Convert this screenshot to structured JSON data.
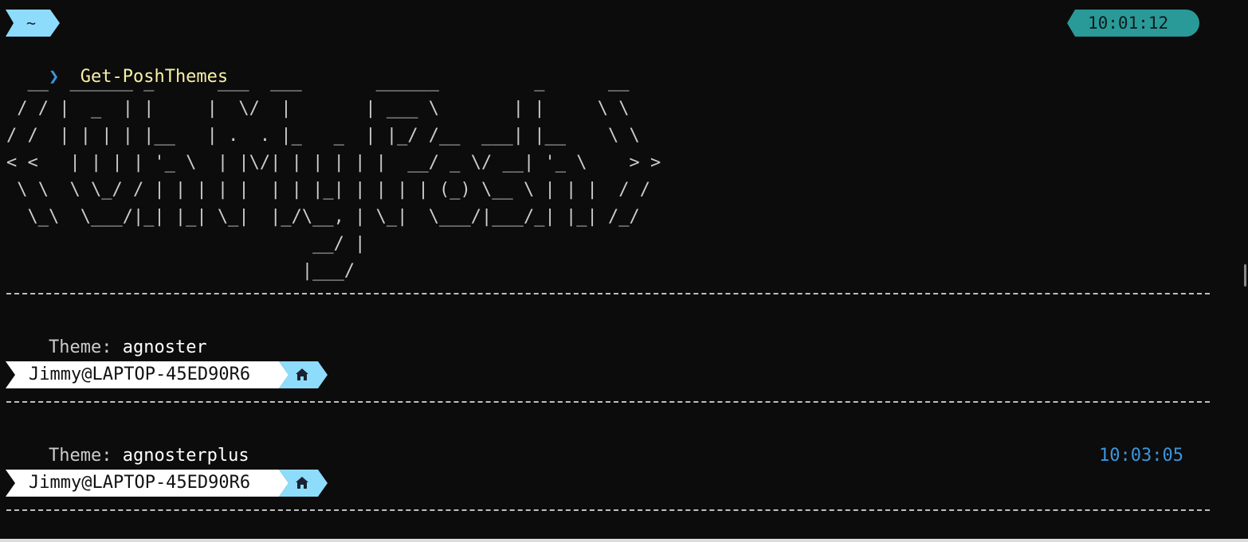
{
  "prompt": {
    "path": "~",
    "time": "10:01:12",
    "chevron": "❯",
    "command": "Get-PoshThemes"
  },
  "banner_ascii": [
    "  __  ______ _      ___  ___       ______         _      __",
    " / / |  _  | |     |  \\/  |       | ___ \\       | |     \\ \\",
    "/ /  | | | | |__   | .  . |_   _  | |_/ /__  ___| |__    \\ \\",
    "< <   | | | | '_ \\  | |\\/| | | | | |  __/ _ \\/ __| '_ \\    > >",
    " \\ \\  \\ \\_/ / | | | | |  | | |_| | | | | (_) \\__ \\ | | |  / /",
    "  \\_\\  \\___/|_| |_| \\_|  |_/\\__, | \\_|  \\___/|___/_| |_| /_/",
    "                             __/ |",
    "                            |___/"
  ],
  "themes": [
    {
      "label": "Theme:",
      "name": "agnoster",
      "user_host": "Jimmy@LAPTOP-45ED90R6",
      "icon": "home-icon",
      "right_time": ""
    },
    {
      "label": "Theme:",
      "name": "agnosterplus",
      "user_host": "Jimmy@LAPTOP-45ED90R6",
      "icon": "home-icon",
      "right_time": "10:03:05"
    }
  ],
  "colors": {
    "background": "#0c0c0c",
    "path_segment": "#8ddcfb",
    "time_segment": "#2a9a98",
    "command": "#f9f1a5",
    "chevron": "#3a96dd"
  }
}
